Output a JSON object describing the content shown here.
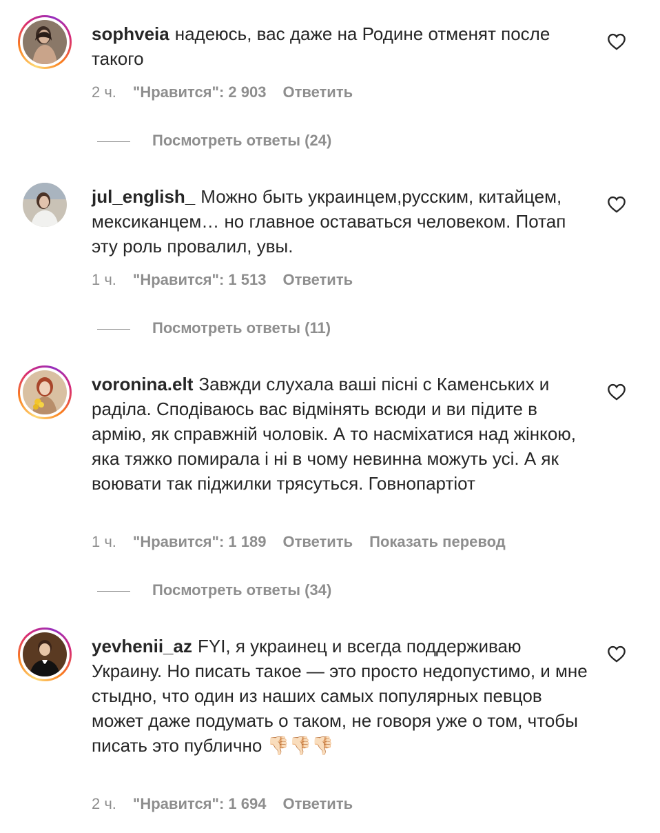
{
  "comments": [
    {
      "username": "sophveia",
      "text": "надеюсь, вас даже на Родине отменят после такого",
      "time": "2 ч.",
      "likes": "\"Нравится\": 2 903",
      "reply": "Ответить",
      "translate": "",
      "view_replies": "Посмотреть ответы (24)",
      "avatar_icon": "user-photo-avatar",
      "story_ring": true
    },
    {
      "username": "jul_english_",
      "text": "Можно быть украинцем,русским, китайцем, мексиканцем… но главное оставаться человеком. Потап эту роль провалил, увы.",
      "time": "1 ч.",
      "likes": "\"Нравится\": 1 513",
      "reply": "Ответить",
      "translate": "",
      "view_replies": "Посмотреть ответы (11)",
      "avatar_icon": "user-photo-avatar",
      "story_ring": false
    },
    {
      "username": "voronina.elt",
      "text": "Завжди слухала ваші пісні с Каменських и раділа. Сподіваюсь вас відмінять всюди и ви підите в армію, як справжній чоловік. А то насміхатися над жінкою, яка тяжко помирала і ні в чому невинна можуть усі. А як воювати так піджилки трясуться. Говнопартіот",
      "time": "1 ч.",
      "likes": "\"Нравится\": 1 189",
      "reply": "Ответить",
      "translate": "Показать перевод",
      "view_replies": "Посмотреть ответы (34)",
      "avatar_icon": "user-photo-avatar",
      "story_ring": true
    },
    {
      "username": "yevhenii_az",
      "text": "FYI, я украинец и всегда поддерживаю Украину. Но писать такое — это просто недопустимо, и мне стыдно, что один из наших самых популярных певцов может даже подумать о таком, не говоря уже о том, чтобы писать это публично 👎🏻👎🏻👎🏻",
      "time": "2 ч.",
      "likes": "\"Нравится\": 1 694",
      "reply": "Ответить",
      "translate": "",
      "view_replies": "",
      "avatar_icon": "user-photo-avatar",
      "story_ring": true
    }
  ],
  "icons": {
    "like": "heart-outline-icon"
  },
  "colors": {
    "text": "#262626",
    "secondary": "#8e8e8e",
    "background": "#ffffff"
  }
}
